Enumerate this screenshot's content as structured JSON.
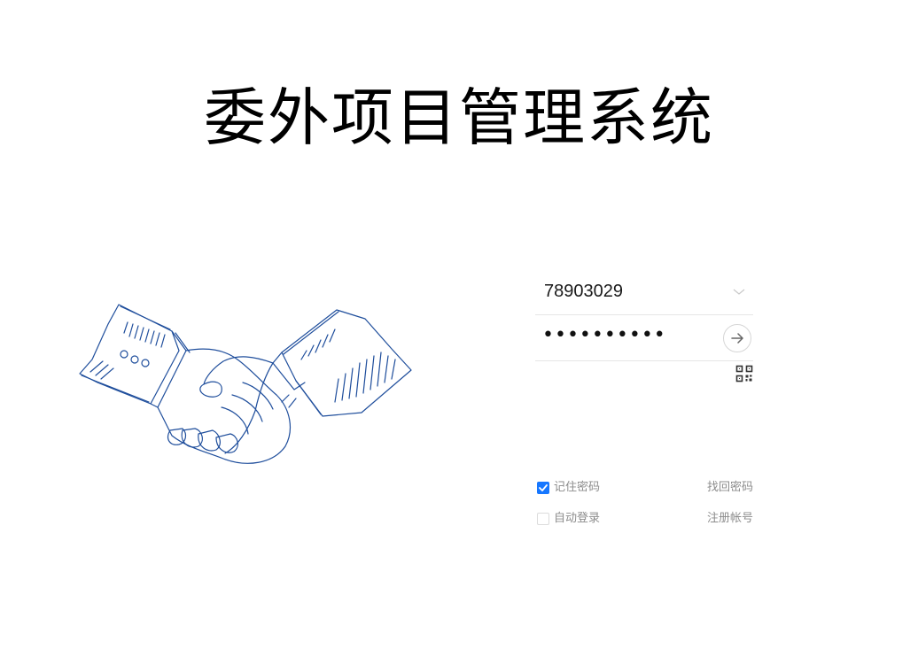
{
  "title": "委外项目管理系统",
  "login": {
    "account_value": "78903029",
    "password_mask": "••••••••••",
    "remember_password": {
      "label": "记住密码",
      "checked": true
    },
    "auto_login": {
      "label": "自动登录",
      "checked": false
    },
    "forgot_password_label": "找回密码",
    "register_label": "注册帐号"
  },
  "icons": {
    "dropdown": "chevron-down-icon",
    "submit": "arrow-right-icon",
    "qr": "qr-code-icon",
    "checkbox": "checkmark-icon"
  },
  "colors": {
    "accent": "#1677ff",
    "illustration_stroke": "#1f4e9c",
    "muted_text": "#8c8c8c",
    "divider": "#e6e6e6"
  }
}
